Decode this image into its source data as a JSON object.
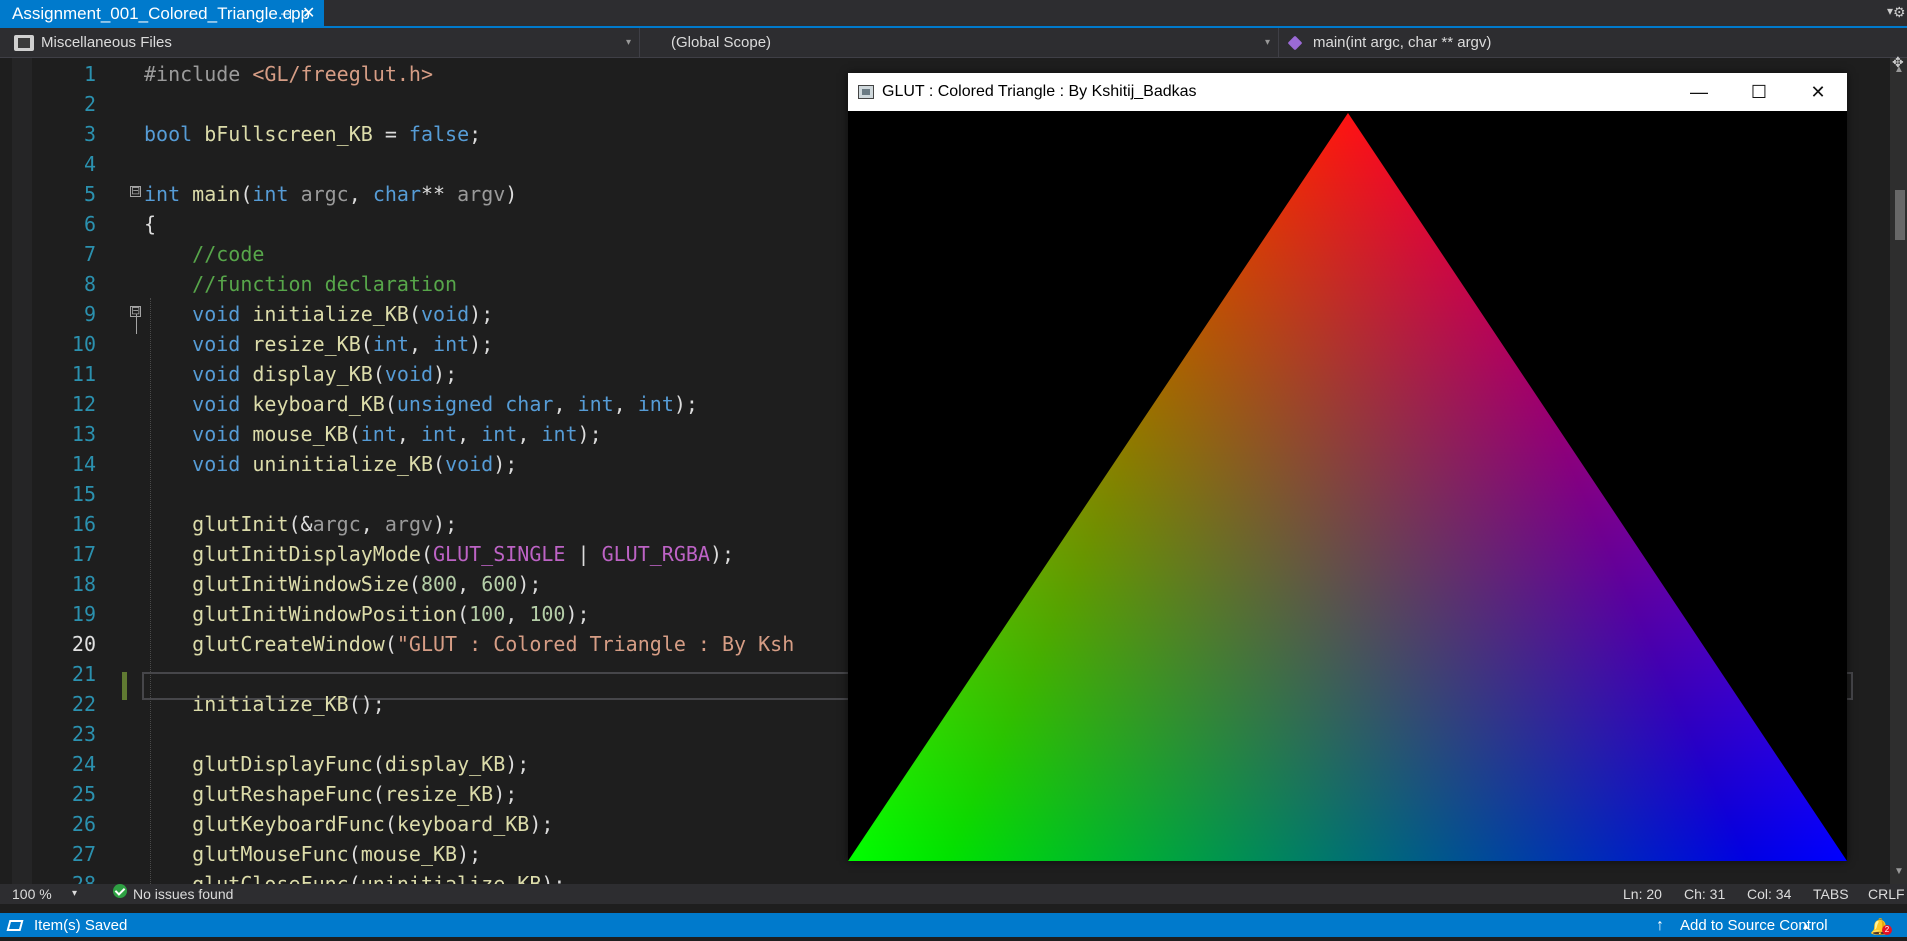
{
  "tab": {
    "title": "Assignment_001_Colored_Triangle.cpp",
    "pin": "⊣",
    "close": "✕"
  },
  "navbar": {
    "project": "Miscellaneous Files",
    "scope": "(Global Scope)",
    "function": "main(int argc, char ** argv)"
  },
  "editor": {
    "line_numbers": [
      "1",
      "2",
      "3",
      "4",
      "5",
      "6",
      "7",
      "8",
      "9",
      "10",
      "11",
      "12",
      "13",
      "14",
      "15",
      "16",
      "17",
      "18",
      "19",
      "20",
      "21",
      "22",
      "23",
      "24",
      "25",
      "26",
      "27",
      "28"
    ],
    "lines": [
      "#include <GL/freeglut.h>",
      "",
      "bool bFullscreen_KB = false;",
      "",
      "int main(int argc, char** argv)",
      "{",
      "    //code",
      "    //function declaration",
      "    void initialize_KB(void);",
      "    void resize_KB(int, int);",
      "    void display_KB(void);",
      "    void keyboard_KB(unsigned char, int, int);",
      "    void mouse_KB(int, int, int, int);",
      "    void uninitialize_KB(void);",
      "",
      "    glutInit(&argc, argv);",
      "    glutInitDisplayMode(GLUT_SINGLE | GLUT_RGBA);",
      "    glutInitWindowSize(800, 600);",
      "    glutInitWindowPosition(100, 100);",
      "    glutCreateWindow(\"GLUT : Colored Triangle : By Ksh",
      "",
      "    initialize_KB();",
      "",
      "    glutDisplayFunc(display_KB);",
      "    glutReshapeFunc(resize_KB);",
      "    glutKeyboardFunc(keyboard_KB);",
      "    glutMouseFunc(mouse_KB);",
      "    glutCloseFunc(uninitialize_KB);"
    ],
    "current_line": "20",
    "folds": [
      "⊟",
      "⊟"
    ]
  },
  "glut_window": {
    "title": "GLUT : Colored Triangle : By Kshitij_Badkas",
    "minimize": "—",
    "maximize": "☐",
    "close": "✕",
    "triangle": {
      "top_color": "#ff0000",
      "left_color": "#00ff00",
      "right_color": "#0000ff",
      "background": "#000000"
    }
  },
  "status": {
    "zoom": "100 %",
    "issues": "No issues found",
    "ln": "Ln: 20",
    "ch": "Ch: 31",
    "col": "Col: 34",
    "tabs": "TABS",
    "eol": "CRLF"
  },
  "statusbar": {
    "saved": "Item(s) Saved",
    "source_control": "Add to Source Control",
    "notifications": "2"
  },
  "colors": {
    "accent": "#007acc",
    "editor_bg": "#1e1e1e",
    "line_number": "#2b91af"
  }
}
